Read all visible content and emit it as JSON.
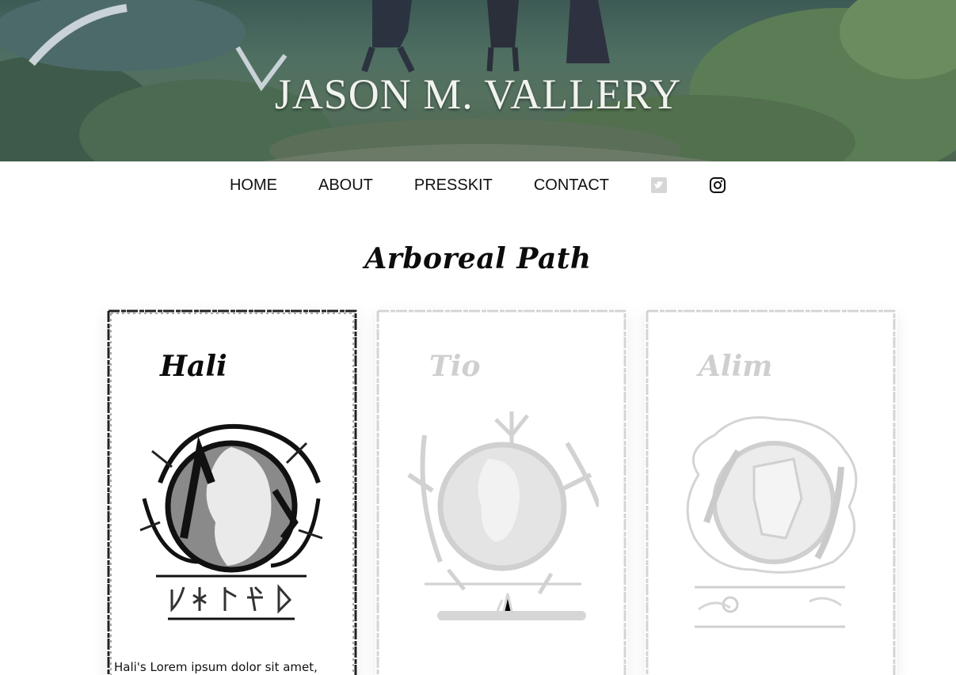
{
  "banner": {
    "title": "JASON M. VALLERY"
  },
  "nav": {
    "links": [
      {
        "label": "HOME"
      },
      {
        "label": "ABOUT"
      },
      {
        "label": "PRESSKIT"
      },
      {
        "label": "CONTACT"
      }
    ],
    "icons": [
      {
        "name": "twitter-icon",
        "color": "#cccccc"
      },
      {
        "name": "instagram-icon",
        "color": "#111111"
      }
    ]
  },
  "page": {
    "heading": "Arboreal Path"
  },
  "cards": [
    {
      "name": "Hali",
      "state": "active",
      "text": "Hali's Lorem ipsum dolor sit amet,"
    },
    {
      "name": "Tio",
      "state": "dim"
    },
    {
      "name": "Alim",
      "state": "dim"
    }
  ],
  "colors": {
    "active_ink": "#111111",
    "dim_ink": "#cfcfcf"
  }
}
